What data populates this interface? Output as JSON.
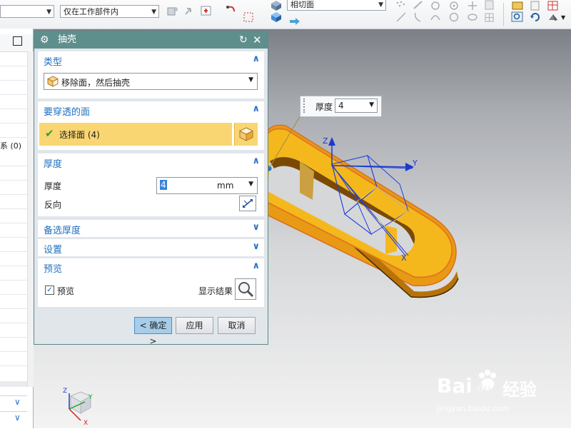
{
  "toolbar": {
    "filter_combo": "",
    "scope_combo": "仅在工作部件内",
    "face_rule_combo": "相切面"
  },
  "navigator": {
    "coord_text": "系 (0)"
  },
  "dialog": {
    "title": "抽壳",
    "type_section": {
      "title": "类型",
      "selected": "移除面，然后抽壳"
    },
    "face_section": {
      "title": "要穿透的面",
      "selected_label": "选择面 (4)"
    },
    "thickness_section": {
      "title": "厚度",
      "thickness_label": "厚度",
      "thickness_value": "4",
      "unit": "mm",
      "reverse_label": "反向"
    },
    "alt_thickness_section": {
      "title": "备选厚度"
    },
    "settings_section": {
      "title": "设置"
    },
    "preview_section": {
      "title": "预览",
      "preview_label": "预览",
      "preview_checked": true,
      "show_result_label": "显示结果"
    },
    "buttons": {
      "ok": "< 确定 >",
      "apply": "应用",
      "cancel": "取消"
    }
  },
  "floating_input": {
    "label": "厚度",
    "value": "4"
  },
  "axes": {
    "z": "Z",
    "y": "Y",
    "x": "X"
  },
  "watermark": {
    "brand": "Bai",
    "brand2": "du",
    "product": "经验",
    "url": "jingyan.baidu.com"
  },
  "colors": {
    "title_bar": "#5f8f8c",
    "section_title": "#1f6fbf",
    "selection_highlight": "#f9d672",
    "part_orange": "#f5a623",
    "ok_button": "#a6cdea"
  }
}
